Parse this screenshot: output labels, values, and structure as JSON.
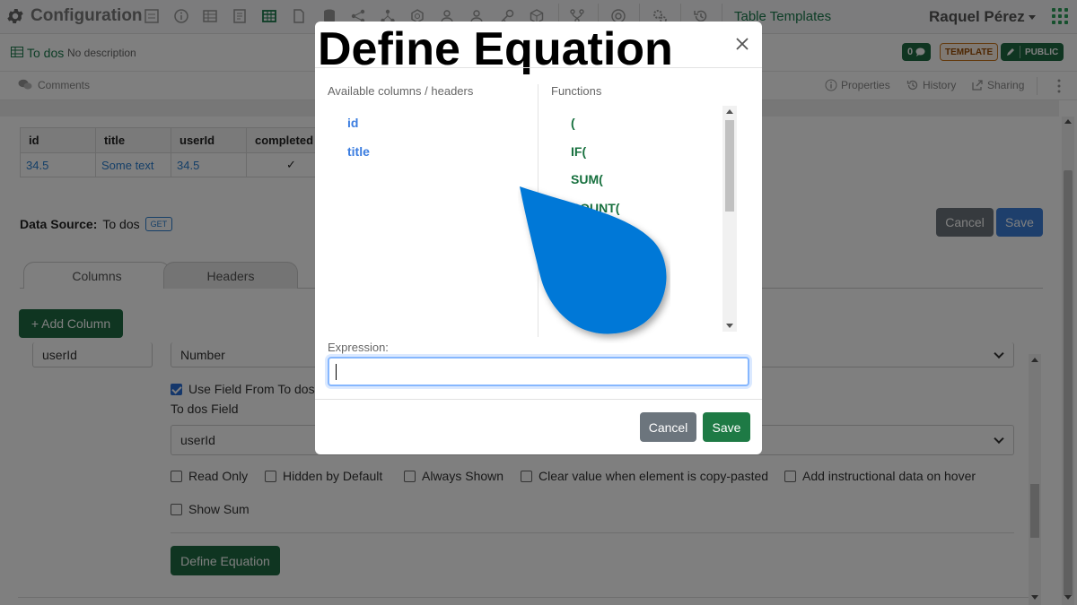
{
  "app": {
    "title": "Configuration",
    "template_link": "Table Templates",
    "user": "Raquel Pérez"
  },
  "record": {
    "name": "To dos",
    "description": "No description",
    "comment_count": "0",
    "template_badge": "TEMPLATE",
    "public_badge": "PUBLIC"
  },
  "actions": {
    "comments": "Comments",
    "properties": "Properties",
    "history": "History",
    "sharing": "Sharing"
  },
  "preview_table": {
    "headers": [
      "id",
      "title",
      "userId",
      "completed"
    ],
    "row": [
      "34.5",
      "Some text",
      "34.5",
      "✓"
    ]
  },
  "datasource": {
    "label": "Data Source:",
    "name": "To dos",
    "method": "GET",
    "cancel": "Cancel",
    "save": "Save"
  },
  "tabs": {
    "columns": "Columns",
    "headers": "Headers"
  },
  "add_column": "+ Add Column",
  "column_editor": {
    "name_value": "userId",
    "type_value": "Number",
    "use_field_label": "Use Field From To dos",
    "field_label": "To dos Field",
    "field_value": "userId",
    "checkboxes": [
      "Read Only",
      "Hidden by Default",
      "Always Shown",
      "Clear value when element is copy-pasted",
      "Add instructional data on hover"
    ],
    "show_sum": "Show Sum",
    "define_equation": "Define Equation"
  },
  "modal": {
    "title": "Define Equation",
    "columns_heading": "Available columns / headers",
    "functions_heading": "Functions",
    "columns": [
      "id",
      "title"
    ],
    "functions": [
      "(",
      "IF(",
      "SUM(",
      "COUNT("
    ],
    "expression_label": "Expression:",
    "expression_value": "",
    "cancel": "Cancel",
    "save": "Save"
  },
  "colors": {
    "brand_green": "#1a7a4c",
    "link_blue": "#2a7fd1",
    "save_blue": "#3d7fd9",
    "cancel_grey": "#6c757d",
    "drop_blue": "#0078d7"
  }
}
